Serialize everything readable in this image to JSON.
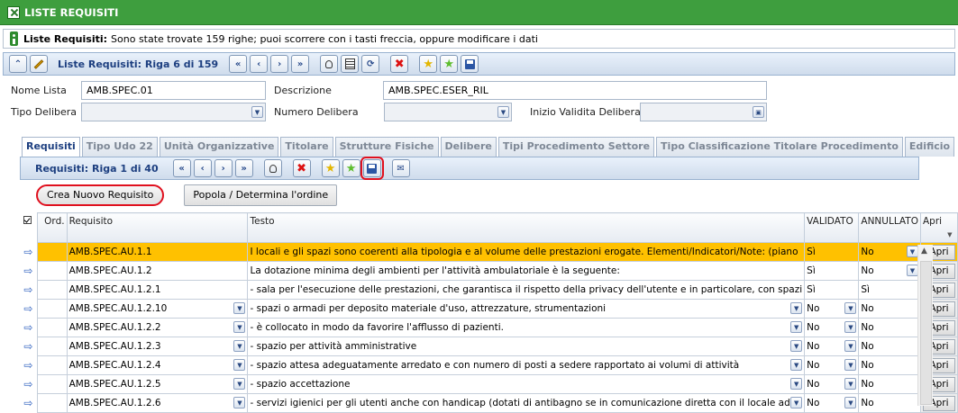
{
  "window": {
    "title": "LISTE REQUISITI"
  },
  "info": {
    "label": "Liste Requisiti:",
    "message": "Sono state trovate 159 righe; puoi scorrere con i tasti freccia, oppure modificare i dati"
  },
  "toolbar": {
    "title": "Liste Requisiti: Riga 6 di 159"
  },
  "form": {
    "nome_lista_label": "Nome Lista",
    "nome_lista_value": "AMB.SPEC.01",
    "descrizione_label": "Descrizione",
    "descrizione_value": "AMB.SPEC.ESER_RIL",
    "tipo_delibera_label": "Tipo Delibera",
    "numero_delibera_label": "Numero Delibera",
    "inizio_validita_label": "Inizio Validita Delibera"
  },
  "tabs": [
    "Requisiti",
    "Tipo Udo 22",
    "Unità Organizzative",
    "Titolare",
    "Strutture Fisiche",
    "Delibere",
    "Tipi Procedimento Settore",
    "Tipo Classificazione Titolare Procedimento",
    "Edificio"
  ],
  "subtoolbar": {
    "title": "Requisiti: Riga 1 di 40"
  },
  "buttons": {
    "crea": "Crea Nuovo Requisito",
    "popola": "Popola / Determina l'ordine"
  },
  "table": {
    "headers": {
      "ord": "Ord.",
      "requisito": "Requisito",
      "testo": "Testo",
      "validato": "VALIDATO",
      "annullato": "ANNULLATO",
      "apri": "Apri"
    },
    "apri_label": "Apri",
    "rows": [
      {
        "requisito": "AMB.SPEC.AU.1.1",
        "testo": "I locali e gli spazi sono coerenti alla tipologia e al volume  delle prestazioni erogate. Elementi/Indicatori/Note: (piano",
        "validato": "Sì",
        "annullato": "No"
      },
      {
        "requisito": "AMB.SPEC.AU.1.2",
        "testo": "La dotazione minima degli ambienti per l'attività ambulatoriale è la seguente:",
        "validato": "Sì",
        "annullato": "No"
      },
      {
        "requisito": "AMB.SPEC.AU.1.2.1",
        "testo": "- sala per l'esecuzione delle prestazioni, che garantisca il rispetto della privacy dell'utente e in particolare, con spazi",
        "validato": "Sì",
        "annullato": "Sì"
      },
      {
        "requisito": "AMB.SPEC.AU.1.2.10",
        "testo": "- spazi o armadi per deposito materiale d'uso, attrezzature, strumentazioni",
        "validato": "No",
        "annullato": "No"
      },
      {
        "requisito": "AMB.SPEC.AU.1.2.2",
        "testo": "- è collocato in modo da favorire l'afflusso di pazienti.",
        "validato": "No",
        "annullato": "No"
      },
      {
        "requisito": "AMB.SPEC.AU.1.2.3",
        "testo": "- spazio per attività amministrative",
        "validato": "No",
        "annullato": "No"
      },
      {
        "requisito": "AMB.SPEC.AU.1.2.4",
        "testo": "- spazio attesa adeguatamente arredato e con numero di posti a sedere rapportato ai volumi di attività",
        "validato": "No",
        "annullato": "No"
      },
      {
        "requisito": "AMB.SPEC.AU.1.2.5",
        "testo": "- spazio accettazione",
        "validato": "No",
        "annullato": "No"
      },
      {
        "requisito": "AMB.SPEC.AU.1.2.6",
        "testo": "- servizi igienici per gli utenti anche con handicap (dotati di antibagno se in comunicazione diretta con il locale ad",
        "validato": "No",
        "annullato": "No"
      }
    ]
  }
}
